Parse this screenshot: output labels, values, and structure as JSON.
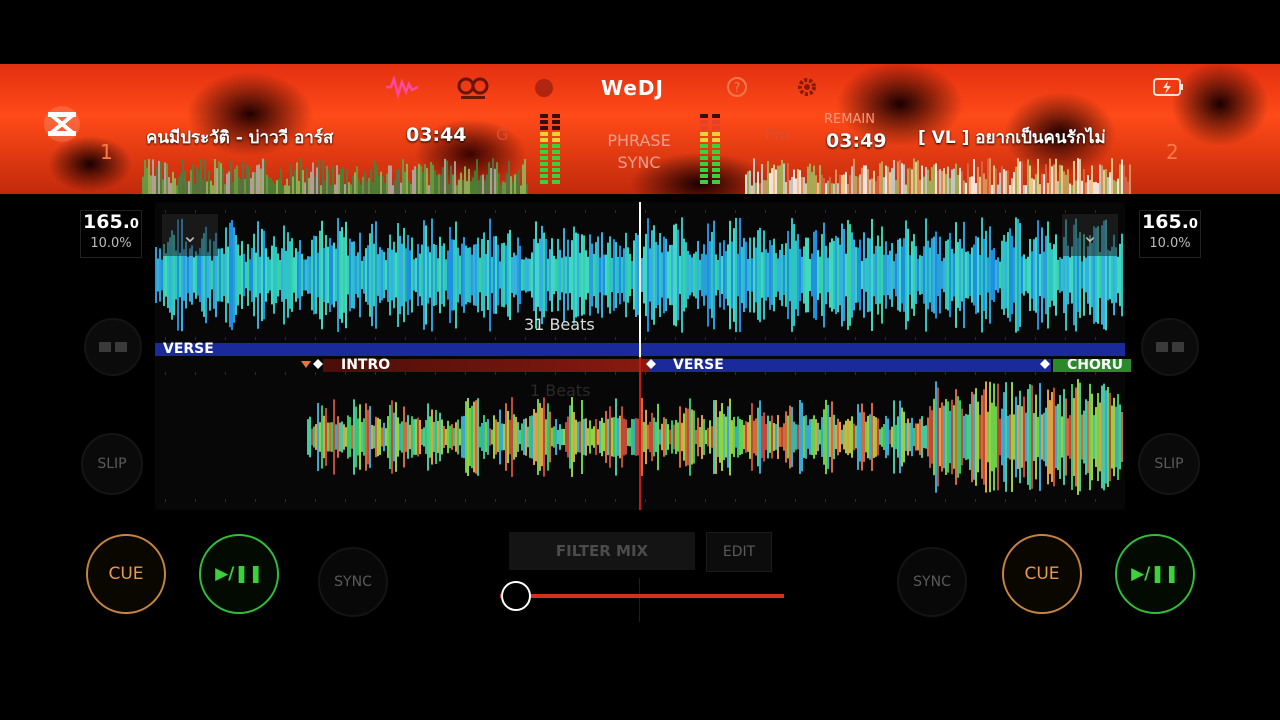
{
  "header": {
    "brand": "WeDJ",
    "deck1_number": "1",
    "deck2_number": "2",
    "deck1_title": "คนมีประวัติ - บ่าววี อาร์ส",
    "deck2_title": "[ VL ] อยากเป็นคนรักไม่",
    "deck1_time": "03:44",
    "deck2_time": "03:49",
    "deck1_key": "G",
    "deck2_key": "Fm",
    "remain_label": "REMAIN",
    "phrase_sync_line1": "PHRASE",
    "phrase_sync_line2": "SYNC",
    "icons": [
      "app-logo-icon",
      "waveform-icon",
      "headphones-icon",
      "record-icon",
      "help-icon",
      "settings-icon",
      "battery-icon"
    ]
  },
  "deck1": {
    "bpm": "165.",
    "bpm_decimal": "0",
    "pitch": "10.0%",
    "beats_label": "31 Beats",
    "phrase_label": "VERSE",
    "slip_label": "SLIP",
    "cue_label": "CUE",
    "play_label": "▶/❚❚",
    "sync_label": "SYNC"
  },
  "deck2": {
    "bpm": "165.",
    "bpm_decimal": "0",
    "pitch": "10.0%",
    "beats_label": "1 Beats",
    "phrases": [
      "INTRO",
      "VERSE",
      "CHORU"
    ],
    "slip_label": "SLIP",
    "cue_label": "CUE",
    "play_label": "▶/❚❚",
    "sync_label": "SYNC"
  },
  "mixer": {
    "filter_mix_label": "FILTER MIX",
    "edit_label": "EDIT",
    "crossfader_position": 0.06
  },
  "colors": {
    "accent_red": "#d4301a",
    "cue_orange": "#e79a4a",
    "play_green": "#3ad13a",
    "phrase_blue": "#1b2a9a",
    "phrase_intro": "#8a1a10",
    "phrase_chorus": "#2a8a2a"
  }
}
